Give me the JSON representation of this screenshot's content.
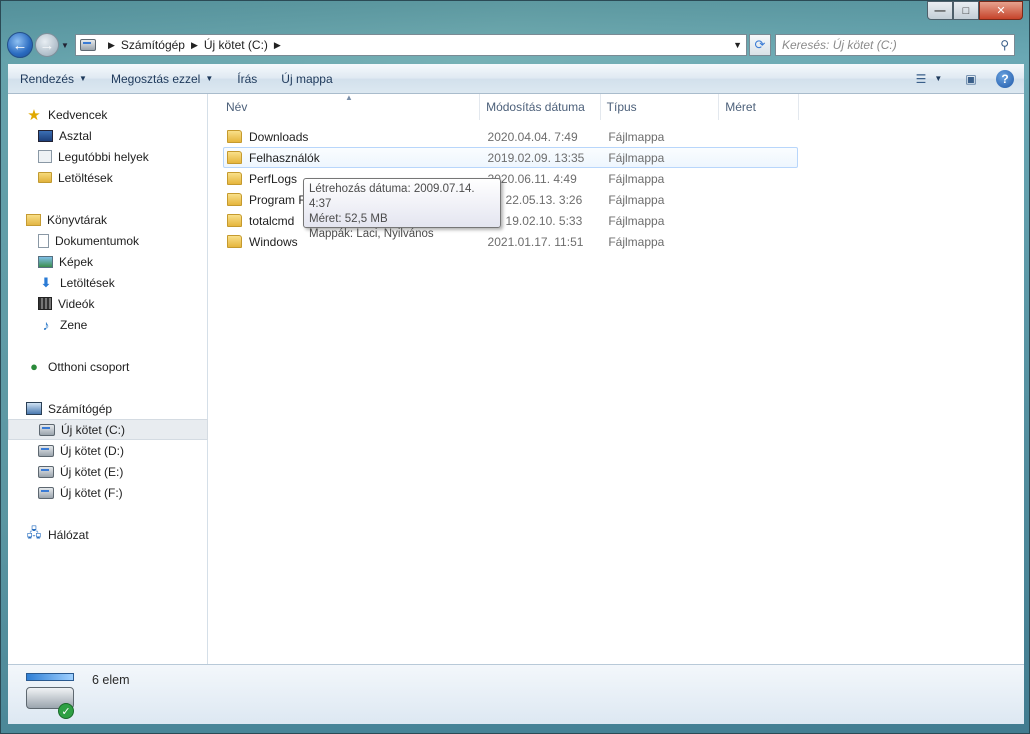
{
  "window": {
    "caption_buttons": {
      "minimize": "—",
      "maximize": "□",
      "close": "✕"
    }
  },
  "address_bar": {
    "crumbs": [
      "Számítógép",
      "Új kötet (C:)"
    ]
  },
  "search": {
    "placeholder": "Keresés: Új kötet (C:)"
  },
  "toolbar": {
    "organize": "Rendezés",
    "share": "Megosztás ezzel",
    "burn": "Írás",
    "new_folder": "Új mappa"
  },
  "sidebar": {
    "favorites": {
      "label": "Kedvencek",
      "items": [
        "Asztal",
        "Legutóbbi helyek",
        "Letöltések"
      ]
    },
    "libraries": {
      "label": "Könyvtárak",
      "items": [
        "Dokumentumok",
        "Képek",
        "Letöltések",
        "Videók",
        "Zene"
      ]
    },
    "homegroup": {
      "label": "Otthoni csoport"
    },
    "computer": {
      "label": "Számítógép",
      "items": [
        "Új kötet (C:)",
        "Új kötet (D:)",
        "Új kötet (E:)",
        "Új kötet (F:)"
      ],
      "selected": "Új kötet (C:)"
    },
    "network": {
      "label": "Hálózat"
    }
  },
  "columns": {
    "name": "Név",
    "date": "Módosítás dátuma",
    "type": "Típus",
    "size": "Méret"
  },
  "files": [
    {
      "name": "Downloads",
      "date": "2020.04.04. 7:49",
      "type": "Fájlmappa"
    },
    {
      "name": "Felhasználók",
      "date": "2019.02.09. 13:35",
      "type": "Fájlmappa"
    },
    {
      "name": "PerfLogs",
      "date": "2020.06.11. 4:49",
      "type": "Fájlmappa"
    },
    {
      "name": "Program F",
      "date": "22.05.13. 3:26",
      "type": "Fájlmappa"
    },
    {
      "name": "totalcmd",
      "date": "19.02.10. 5:33",
      "type": "Fájlmappa"
    },
    {
      "name": "Windows",
      "date": "2021.01.17. 11:51",
      "type": "Fájlmappa"
    }
  ],
  "tooltip": {
    "created": "Létrehozás dátuma: 2009.07.14. 4:37",
    "size": "Méret: 52,5 MB",
    "folders": "Mappák: Laci, Nyilvános"
  },
  "status": {
    "count": "6 elem"
  },
  "colors": {
    "accent": "#3a7bd5",
    "folder": "#e5b53c",
    "hover_border": "#b8d6fb"
  }
}
